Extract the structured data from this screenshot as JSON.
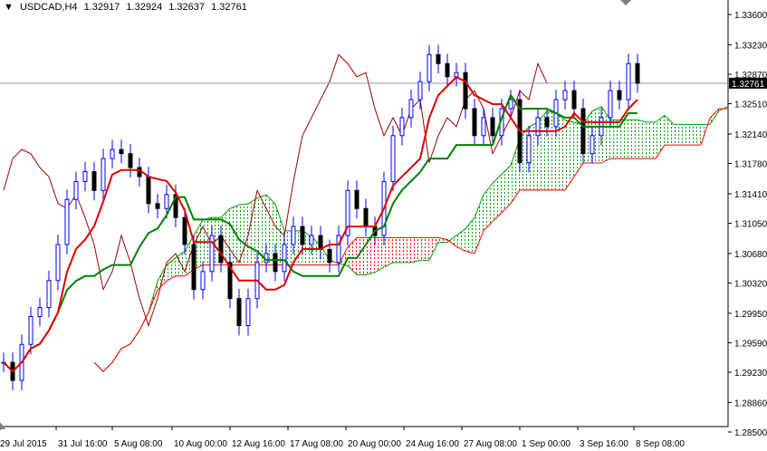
{
  "header": {
    "arrow": "▼",
    "symbol": "USDCAD,H4",
    "open": "1.32917",
    "high": "1.32924",
    "low": "1.32637",
    "close": "1.32761"
  },
  "chart_data": {
    "type": "candlestick",
    "symbol": "USDCAD",
    "timeframe": "H4",
    "ylim": [
      1.285,
      1.3375
    ],
    "yticks": [
      "1.33600",
      "1.33230",
      "1.32870",
      "1.32510",
      "1.32140",
      "1.31780",
      "1.31410",
      "1.31050",
      "1.30680",
      "1.30320",
      "1.29950",
      "1.29590",
      "1.29230",
      "1.28860",
      "1.28500"
    ],
    "xticks": [
      "29 Jul 2015",
      "31 Jul 16:00",
      "5 Aug 08:00",
      "10 Aug 00:00",
      "12 Aug 16:00",
      "17 Aug 08:00",
      "20 Aug 00:00",
      "24 Aug 16:00",
      "27 Aug 08:00",
      "1 Sep 00:00",
      "3 Sep 16:00",
      "8 Sep 08:00"
    ],
    "current_price": "1.32761",
    "closes": [
      1.2935,
      1.2913,
      1.2957,
      1.2991,
      1.3002,
      1.3035,
      1.3079,
      1.3134,
      1.3156,
      1.3168,
      1.3145,
      1.3184,
      1.3195,
      1.319,
      1.3173,
      1.3162,
      1.3129,
      1.3123,
      1.314,
      1.3112,
      1.3079,
      1.3024,
      1.3046,
      1.309,
      1.3057,
      1.3013,
      1.298,
      1.3013,
      1.3057,
      1.3068,
      1.3046,
      1.3079,
      1.3101,
      1.3079,
      1.309,
      1.3073,
      1.3057,
      1.309,
      1.3145,
      1.3123,
      1.3101,
      1.309,
      1.3156,
      1.3212,
      1.3234,
      1.3256,
      1.3278,
      1.3311,
      1.33,
      1.3284,
      1.3289,
      1.3245,
      1.3212,
      1.3234,
      1.3212,
      1.3245,
      1.3256,
      1.3179,
      1.3212,
      1.3234,
      1.3223,
      1.3256,
      1.3267,
      1.3245,
      1.319,
      1.3212,
      1.3234,
      1.3267,
      1.3256,
      1.33,
      1.32761
    ],
    "indicator": "Ichimoku Kinko Hyo",
    "colors": {
      "tenkan": "#e00000",
      "kijun": "#008000",
      "chikou": "#a00000",
      "cloud_up": "#00a000",
      "cloud_down": "#ff0000",
      "candle": "#0000ff"
    }
  }
}
